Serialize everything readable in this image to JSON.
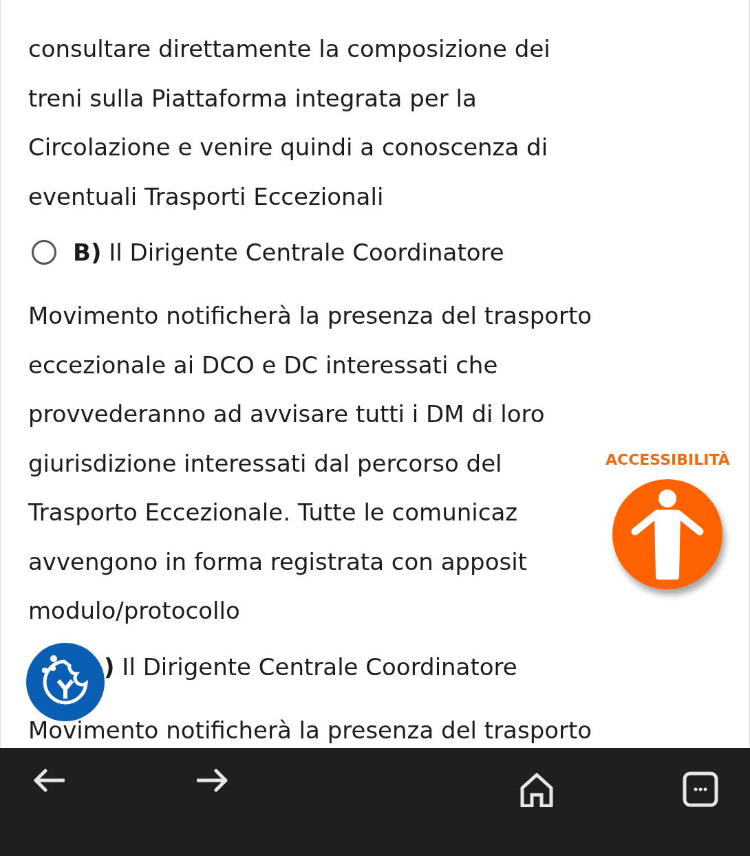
{
  "question_text_lines": [
    "consultare direttamente la composizione dei",
    "treni sulla Piattaforma integrata per la",
    "Circolazione e venire quindi a conoscenza di",
    "eventuali Trasporti Eccezionali"
  ],
  "options": [
    {
      "letter": "B)",
      "first_line": "Il Dirigente Centrale Coordinatore",
      "lines": [
        "Movimento notificherà la presenza del trasporto",
        "eccezionale ai DCO e DC interessati che",
        "provvederanno ad avvisare tutti i DM di loro",
        "giurisdizione interessati dal percorso del",
        "Trasporto Eccezionale. Tutte le comunicaz",
        "avvengono in forma registrata con apposit",
        "modulo/protocollo"
      ],
      "selected": false
    },
    {
      "letter": ")",
      "first_line": "Il Dirigente Centrale Coordinatore",
      "lines": [
        "Movimento notificherà la presenza del trasporto"
      ]
    }
  ],
  "accessibility_widget": {
    "label": "ACCESSIBILITÀ"
  }
}
